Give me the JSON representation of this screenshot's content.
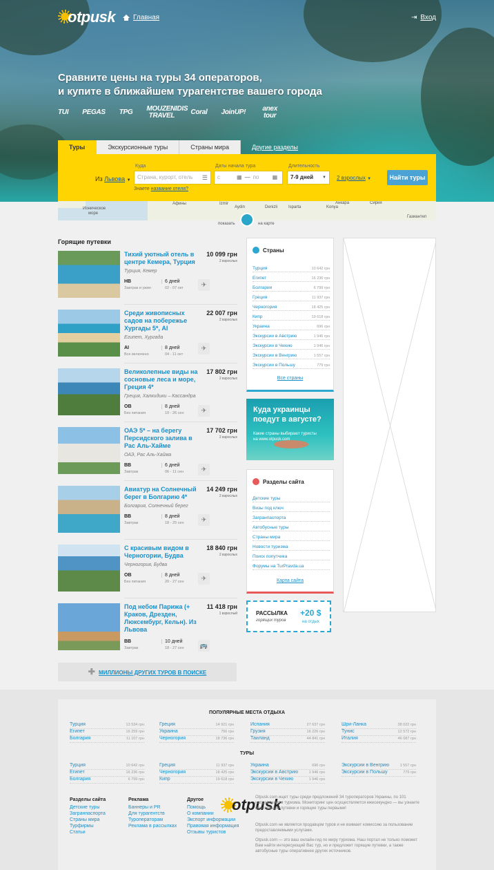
{
  "header": {
    "logo": "otpusk",
    "home": "Главная",
    "login": "Вход"
  },
  "hero": {
    "headline1": "Сравните цены на туры 34 операторов,",
    "headline2": "и купите в ближайшем турагентстве вашего города"
  },
  "operators": [
    "TUI",
    "PEGAS",
    "TPG",
    "MOUZENIDIS TRAVEL",
    "Coral",
    "JoinUP!",
    "anex tour"
  ],
  "tabs": [
    "Туры",
    "Экскурсионные туры",
    "Страны мира",
    "Другие разделы"
  ],
  "search": {
    "from_prefix": "Из",
    "from_city": "Львова",
    "where_label": "Куда",
    "where_placeholder": "Страна, курорт, отель",
    "date_label": "Даты начала тура",
    "date_from": "с",
    "date_to": "по",
    "dash": "—",
    "duration_label": "Длительность",
    "duration": "7-9 дней",
    "adults": "2 взрослых",
    "button": "Найти туры",
    "hint_prefix": "Знаете",
    "hint_link": "название отеля?"
  },
  "map": {
    "labels": [
      "Ионическое",
      "море",
      "Афины",
      "Izmir",
      "Aydin",
      "Denizli",
      "Isparta",
      "Konya",
      "Сирия",
      "Газиантеп",
      "Анкара"
    ],
    "show": "показать",
    "on_map": "на карте"
  },
  "hot": {
    "title": "Горящие путевки",
    "deals": [
      {
        "title": "Тихий уютный отель в центре Кемера, Турция",
        "price": "10 099 грн",
        "pax": "2 взрослых",
        "loc": "Турция, Кемер",
        "board": "HB",
        "board_l": "Завтрак и ужин",
        "days": "6 дней",
        "dates": "02 - 07 окт",
        "trans": "✈"
      },
      {
        "title": "Среди живописных садов на побережье Хургады 5*, AI",
        "price": "22 007 грн",
        "pax": "2 взрослых",
        "loc": "Египет, Хургада",
        "board": "AI",
        "board_l": "Все включено",
        "days": "8 дней",
        "dates": "04 - 11 окт",
        "trans": "✈"
      },
      {
        "title": "Великолепные виды на сосновые леса и море, Греция 4*",
        "price": "17 802 грн",
        "pax": "2 взрослых",
        "loc": "Греция, Халкидики – Кассандра",
        "board": "OB",
        "board_l": "Без питания",
        "days": "8 дней",
        "dates": "19 - 26 сен",
        "trans": "✈"
      },
      {
        "title": "ОАЭ 5* – на берегу Персидского залива в Рас Аль-Хайме",
        "price": "17 702 грн",
        "pax": "2 взрослых",
        "loc": "ОАЭ, Рас Аль-Хайма",
        "board": "BB",
        "board_l": "Завтрак",
        "days": "6 дней",
        "dates": "06 - 11 сен",
        "trans": "✈"
      },
      {
        "title": "Авиатур на Солнечный берег в Болгарию 4*",
        "price": "14 249 грн",
        "pax": "2 взрослых",
        "loc": "Болгария, Солнечный берег",
        "board": "BB",
        "board_l": "Завтрак",
        "days": "8 дней",
        "dates": "18 - 25 сен",
        "trans": "✈"
      },
      {
        "title": "С красивым видом в Черногории, Будва",
        "price": "18 840 грн",
        "pax": "2 взрослых",
        "loc": "Черногория, Будва",
        "board": "OB",
        "board_l": "Без питания",
        "days": "8 дней",
        "dates": "20 - 27 сен",
        "trans": "✈"
      },
      {
        "title": "Под небом Парижа (+ Краков, Дрезден, Люксембург, Кельн). Из Львова",
        "price": "11 418 грн",
        "pax": "1 взрослый",
        "loc": "",
        "board": "BB",
        "board_l": "Завтрак",
        "days": "10 дней",
        "dates": "18 - 27 сен",
        "trans": "🚌"
      }
    ],
    "more": "МИЛЛИОНЫ ДРУГИХ ТУРОВ В ПОИСКЕ"
  },
  "countries": {
    "title": "Страны",
    "items": [
      {
        "n": "Турция",
        "p": "10 642 грн"
      },
      {
        "n": "Египет",
        "p": "16 236 грн"
      },
      {
        "n": "Болгария",
        "p": "6 799 грн"
      },
      {
        "n": "Греция",
        "p": "11 937 грн"
      },
      {
        "n": "Черногория",
        "p": "18 425 грн"
      },
      {
        "n": "Кипр",
        "p": "19 618 грн"
      },
      {
        "n": "Украина",
        "p": "696 грн"
      },
      {
        "n": "Экскурсии в Австрию",
        "p": "1 946 грн"
      },
      {
        "n": "Экскурсии в Чехию",
        "p": "1 946 грн"
      },
      {
        "n": "Экскурсии в Венгрию",
        "p": "1 557 грн"
      },
      {
        "n": "Экскурсии в Польшу",
        "p": "779 грн"
      }
    ],
    "all": "Все страны"
  },
  "promo": {
    "t1": "Куда украинцы",
    "t2": "поедут в августе?",
    "t3": "Какие страны выбирают туристы",
    "t4": "на www.otpusk.com"
  },
  "sections": {
    "title": "Разделы сайта",
    "items": [
      "Детские туры",
      "Визы под ключ",
      "Загранпаспорта",
      "Автобусные туры",
      "Страны мира",
      "Новости туризма",
      "Поиск попутчика",
      "Форумы на TurPravda.ua"
    ],
    "map": "Карта сайта"
  },
  "subscribe": {
    "a": "РАССЫЛКА",
    "b": "горящих туров",
    "c": "+20 $",
    "d": "на отдых"
  },
  "footer": {
    "popular_title": "ПОПУЛЯРНЫЕ МЕСТА ОТДЫХА",
    "popular": [
      [
        {
          "n": "Турция",
          "p": "13 534 грн"
        },
        {
          "n": "Египет",
          "p": "16 259 грн"
        },
        {
          "n": "Болгария",
          "p": "11 107 грн"
        }
      ],
      [
        {
          "n": "Греция",
          "p": "14 921 грн"
        },
        {
          "n": "Украина",
          "p": "756 грн"
        },
        {
          "n": "Черногория",
          "p": "18 736 грн"
        }
      ],
      [
        {
          "n": "Испания",
          "p": "27 637 грн"
        },
        {
          "n": "Грузия",
          "p": "16 226 грн"
        },
        {
          "n": "Таиланд",
          "p": "44 841 грн"
        }
      ],
      [
        {
          "n": "Шри-Ланка",
          "p": "38 022 грн"
        },
        {
          "n": "Тунис",
          "p": "12 572 грн"
        },
        {
          "n": "Италия",
          "p": "46 087 грн"
        }
      ]
    ],
    "tours_title": "ТУРЫ",
    "tours": [
      [
        {
          "n": "Турция",
          "p": "10 642 грн"
        },
        {
          "n": "Египет",
          "p": "16 236 грн"
        },
        {
          "n": "Болгария",
          "p": "6 799 грн"
        }
      ],
      [
        {
          "n": "Греция",
          "p": "11 937 грн"
        },
        {
          "n": "Черногория",
          "p": "18 425 грн"
        },
        {
          "n": "Кипр",
          "p": "19 618 грн"
        }
      ],
      [
        {
          "n": "Украина",
          "p": "696 грн"
        },
        {
          "n": "Экскурсии в Австрию",
          "p": "1 946 грн"
        },
        {
          "n": "Экскурсии в Чехию",
          "p": "1 946 грн"
        }
      ],
      [
        {
          "n": "Экскурсии в Венгрию",
          "p": "1 557 грн"
        },
        {
          "n": "Экскурсии в Польшу",
          "p": "779 грн"
        }
      ]
    ],
    "cols": [
      {
        "h": "Разделы сайта",
        "l": [
          "Детские туры",
          "Загранпаспорта",
          "Страны мира",
          "Турфирмы",
          "Статьи"
        ]
      },
      {
        "h": "Реклама",
        "l": [
          "Баннеры и PR",
          "Для турагентств",
          "Туроператорам",
          "Реклама в рассылках"
        ]
      },
      {
        "h": "Другое",
        "l": [
          "Помощь",
          "О компании",
          "Экспорт информации",
          "Правовая информация",
          "Отзывы туристов"
        ]
      }
    ],
    "logo": "otpusk",
    "text1": "Otpusk.com ищет туры среди предложений 34 туроператоров Украины, по 101 направлениям туризма. Мониторинг цен осуществляется ежесекундно — вы узнаете про горящие путевки и горящие туры первыми!",
    "text2": "Otpusk.com не является продавцом туров и не взимает комиссию за пользование предоставляемыми услугами.",
    "text3": "Otpusk.com — это ваш онлайн-гид по миру туризма. Наш портал не только поможет Вам найти интересующий Вас тур, но и предложит горящие путевки, а также автобусные туры оперативнее других источников."
  },
  "colors": {
    "yellow": "#ffd400",
    "blue": "#1a8fc8",
    "btn": "#4aa3d4"
  }
}
